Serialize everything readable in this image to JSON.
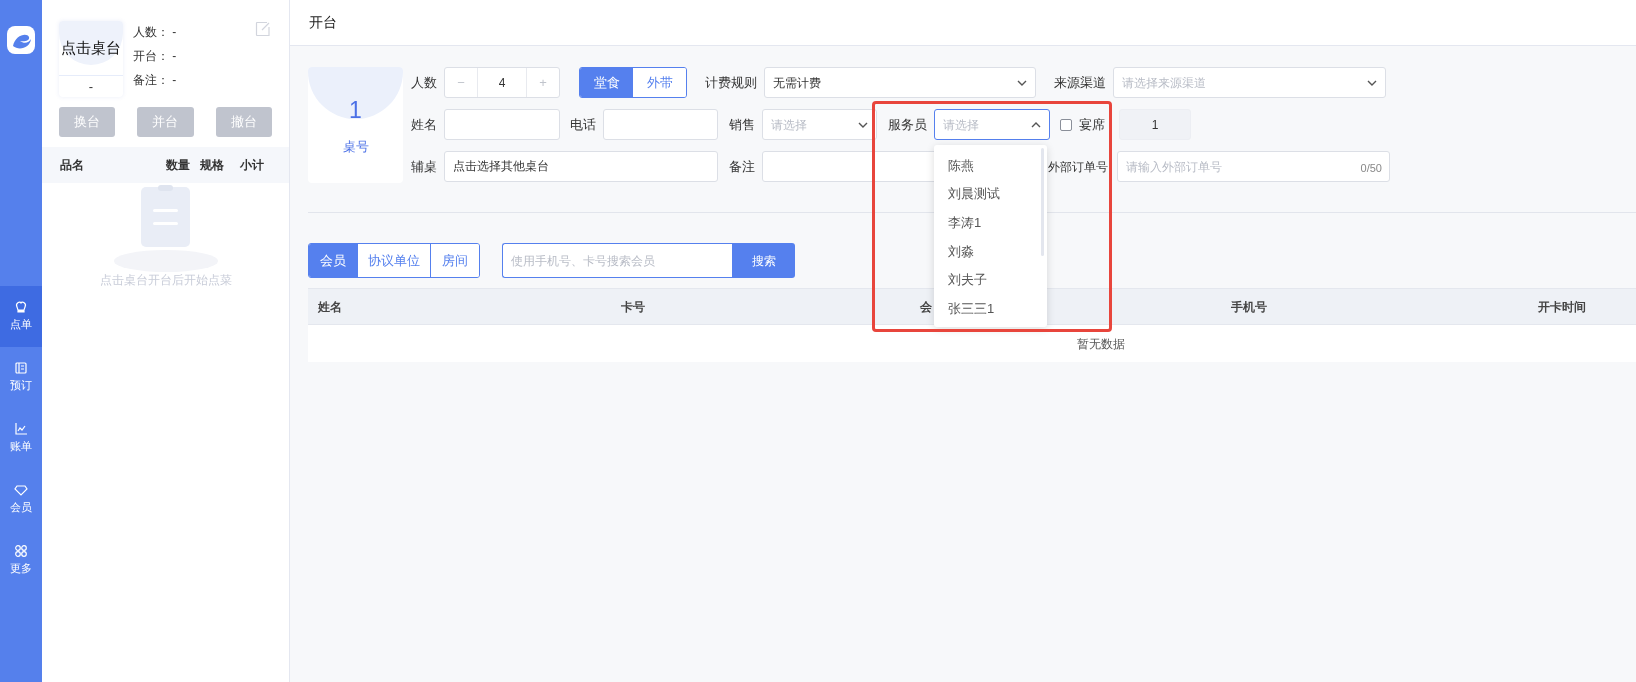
{
  "sidebar": {
    "items": [
      {
        "label": "点单",
        "selected": true
      },
      {
        "label": "预订",
        "selected": false
      },
      {
        "label": "账单",
        "selected": false
      },
      {
        "label": "会员",
        "selected": false
      },
      {
        "label": "更多",
        "selected": false
      }
    ]
  },
  "order_panel": {
    "table_name": "点击桌台",
    "table_code": "-",
    "info": [
      "人数： -",
      "开台： -",
      "备注： -"
    ],
    "actions": [
      {
        "label": "换台",
        "disabled": true
      },
      {
        "label": "并台",
        "disabled": true
      },
      {
        "label": "撤台",
        "disabled": true
      }
    ],
    "columns": [
      "品名",
      "数量",
      "规格",
      "小计"
    ],
    "empty_text": "点击桌台开台后开始点菜"
  },
  "page": {
    "title": "开台"
  },
  "table_card": {
    "number": "1",
    "label": "桌号"
  },
  "form": {
    "fields": [
      {
        "kind": "stepper",
        "label": "人数",
        "minus": "−",
        "value": "4",
        "plus": "+"
      },
      {
        "kind": "toggle",
        "options": [
          {
            "label": "堂食",
            "selected": true
          },
          {
            "label": "外带",
            "selected": false
          }
        ]
      },
      {
        "kind": "select",
        "label": "计费规则",
        "value": "无需计费"
      },
      {
        "kind": "select",
        "label": "来源渠道",
        "placeholder": "请选择来源渠道"
      },
      {
        "kind": "input",
        "label": "姓名"
      },
      {
        "kind": "input",
        "label": "电话"
      },
      {
        "kind": "select",
        "label": "销售",
        "placeholder": "请选择"
      },
      {
        "kind": "select",
        "label": "服务员",
        "placeholder": "请选择",
        "open": true,
        "options": [
          "陈燕",
          "刘晨测试",
          "李涛1",
          "刘淼",
          "刘夫子",
          "张三三1"
        ]
      },
      {
        "kind": "checkbox",
        "label": "宴席",
        "checked": false
      },
      {
        "kind": "input",
        "value": "1",
        "disabled": true
      },
      {
        "kind": "input",
        "label": "辅桌",
        "value": "点击选择其他桌台"
      },
      {
        "kind": "input",
        "label": "备注"
      },
      {
        "kind": "input",
        "label": "外部订单号",
        "placeholder": "请输入外部订单号",
        "counter": "0/50"
      }
    ]
  },
  "member_search": {
    "tabs": [
      {
        "label": "会员",
        "selected": true
      },
      {
        "label": "协议单位",
        "selected": false
      },
      {
        "label": "房间",
        "selected": false
      }
    ],
    "placeholder": "使用手机号、卡号搜索会员",
    "button": "搜索"
  },
  "member_table": {
    "columns": [
      "姓名",
      "卡号",
      "会",
      "手机号",
      "开卡时间"
    ],
    "empty_text": "暂无数据"
  },
  "annotations": [
    {
      "kind": "frame"
    }
  ]
}
